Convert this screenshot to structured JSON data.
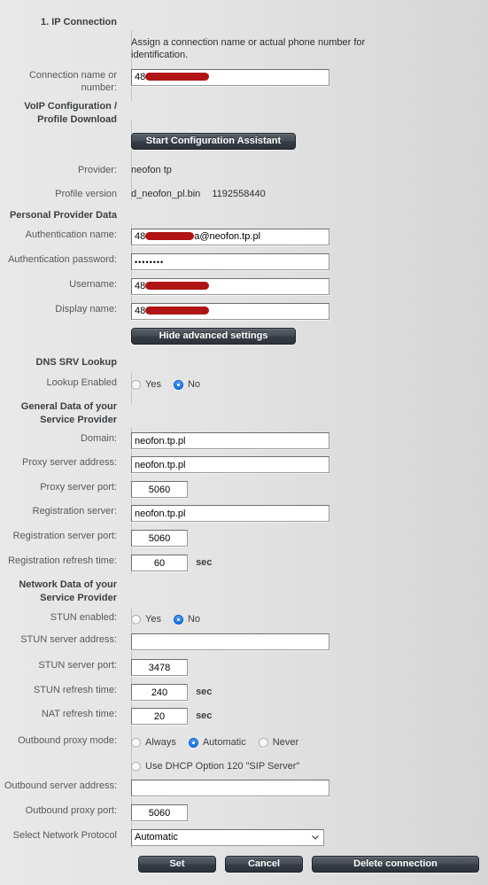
{
  "section_title": "1. IP Connection",
  "hint": "Assign a connection name or actual phone number for identification.",
  "labels": {
    "connection_name": "Connection name or number:",
    "voip_config": "VoIP Configuration / Profile Download",
    "provider": "Provider:",
    "profile_version": "Profile version",
    "personal_provider_data": "Personal Provider Data",
    "auth_name": "Authentication name:",
    "auth_password": "Authentication password:",
    "username": "Username:",
    "display_name": "Display name:",
    "dns_srv_lookup": "DNS SRV Lookup",
    "lookup_enabled": "Lookup Enabled",
    "general_data": "General Data of your Service Provider",
    "domain": "Domain:",
    "proxy_server_address": "Proxy server address:",
    "proxy_server_port": "Proxy server port:",
    "registration_server": "Registration server:",
    "registration_server_port": "Registration server port:",
    "registration_refresh_time": "Registration refresh time:",
    "network_data": "Network Data of your Service Provider",
    "stun_enabled": "STUN enabled:",
    "stun_server_address": "STUN server address:",
    "stun_server_port": "STUN server port:",
    "stun_refresh_time": "STUN refresh time:",
    "nat_refresh_time": "NAT refresh time:",
    "outbound_proxy_mode": "Outbound proxy mode:",
    "outbound_server_address": "Outbound server address:",
    "outbound_proxy_port": "Outbound proxy port:",
    "select_network_protocol": "Select Network Protocol"
  },
  "values": {
    "connection_name_prefix": "48",
    "provider": "neofon tp",
    "profile_file": "d_neofon_pl.bin",
    "profile_number": "1192558440",
    "auth_name_prefix": "48",
    "auth_name_suffix": "a@neofon.tp.pl",
    "auth_password": "••••••••",
    "username_prefix": "48",
    "display_name_prefix": "48",
    "domain": "neofon.tp.pl",
    "proxy_server_address": "neofon.tp.pl",
    "proxy_server_port": "5060",
    "registration_server": "neofon.tp.pl",
    "registration_server_port": "5060",
    "registration_refresh_time": "60",
    "stun_server_address": "",
    "stun_server_port": "3478",
    "stun_refresh_time": "240",
    "nat_refresh_time": "20",
    "outbound_server_address": "",
    "outbound_proxy_port": "5060",
    "network_protocol": "Automatic"
  },
  "units": {
    "sec": "sec"
  },
  "radios": {
    "lookup_enabled": {
      "options": [
        "Yes",
        "No"
      ],
      "selected": "No"
    },
    "stun_enabled": {
      "options": [
        "Yes",
        "No"
      ],
      "selected": "No"
    },
    "outbound_proxy_mode": {
      "options": [
        "Always",
        "Automatic",
        "Never",
        "Use DHCP Option 120 \"SIP Server\""
      ],
      "selected": "Automatic"
    }
  },
  "select_options": [
    "Automatic"
  ],
  "buttons": {
    "start_assistant": "Start Configuration Assistant",
    "hide_advanced": "Hide advanced settings",
    "set": "Set",
    "cancel": "Cancel",
    "delete_connection": "Delete connection"
  },
  "colors": {
    "background": "#e4e4e4",
    "redaction": "#b01414",
    "radio_selected": "#1273e6",
    "button_dark": "#3b414a",
    "divider": "#c3c3c3"
  },
  "placeholders": {
    "empty": ""
  }
}
